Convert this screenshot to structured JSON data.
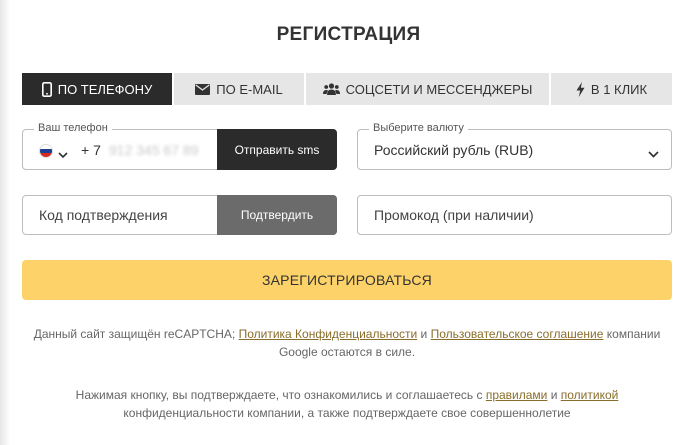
{
  "title": "РЕГИСТРАЦИЯ",
  "tabs": [
    {
      "label": "ПО ТЕЛЕФОНУ",
      "icon": "phone-icon",
      "active": true
    },
    {
      "label": "ПО E-MAIL",
      "icon": "envelope-icon",
      "active": false
    },
    {
      "label": "СОЦСЕТИ И МЕССЕНДЖЕРЫ",
      "icon": "users-icon",
      "active": false
    },
    {
      "label": "В 1 КЛИК",
      "icon": "lightning-icon",
      "active": false
    }
  ],
  "phone": {
    "label": "Ваш телефон",
    "country_code": "+ 7",
    "number_placeholder": "912 345 67 89",
    "send_sms_label": "Отправить sms",
    "flag_colors": [
      "#ffffff",
      "#1c3f94",
      "#d52b1e"
    ]
  },
  "currency": {
    "label": "Выберите валюту",
    "value": "Российский рубль (RUB)"
  },
  "confirmation": {
    "placeholder": "Код подтверждения",
    "button_label": "Подтвердить"
  },
  "promo": {
    "placeholder": "Промокод (при наличии)"
  },
  "register_label": "ЗАРЕГИСТРИРОВАТЬСЯ",
  "recaptcha_note": {
    "before": "Данный сайт защищён reCAPTCHA; ",
    "privacy_link": "Политика Конфиденциальности",
    "and": " и ",
    "terms_link": "Пользовательское соглашение",
    "after": " компании Google остаются в силе."
  },
  "consent_note": {
    "before": "Нажимая кнопку, вы подтверждаете, что ознакомились и соглашаетесь с ",
    "rules_link": "правилами",
    "and": " и ",
    "policy_link": "политикой",
    "after": " конфиденциальности компании, а также подтверждаете свое совершеннолетие"
  },
  "colors": {
    "accent_yellow": "#fdd369",
    "dark": "#2b2b2b",
    "tab_bg": "#e6e6e6",
    "link": "#8a6d2a"
  }
}
